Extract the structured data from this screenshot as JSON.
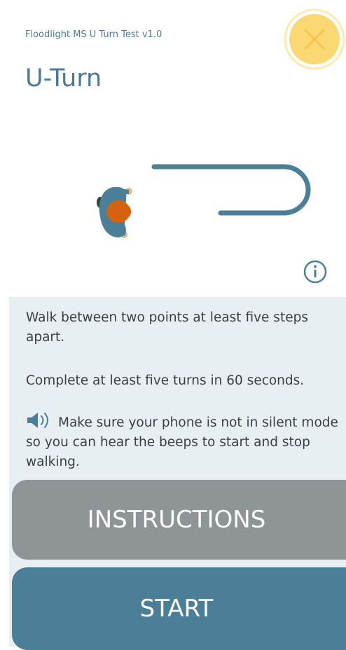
{
  "header": {
    "app_name": "Floodlight MS U Turn Test v1.0",
    "title": "U-Turn"
  },
  "instructions_panel": {
    "line1": "Walk between two points at least five steps apart.",
    "line2": "Complete at least five turns in 60 seconds.",
    "line3": "Make sure your phone is not in silent mode so you can hear the beeps to start and stop walking."
  },
  "buttons": {
    "instructions_label": "INSTRUCTIONS",
    "start_label": "START"
  },
  "icons": {
    "close": "close-icon",
    "info": "info-icon",
    "speaker": "speaker-icon"
  },
  "colors": {
    "accent_blue": "#4b7f97",
    "title_blue": "#4a7a94",
    "close_yellow": "#fcd872",
    "panel_bg": "#e8eff3",
    "instructions_gray": "#8f9596",
    "hair_orange": "#d7620e"
  }
}
